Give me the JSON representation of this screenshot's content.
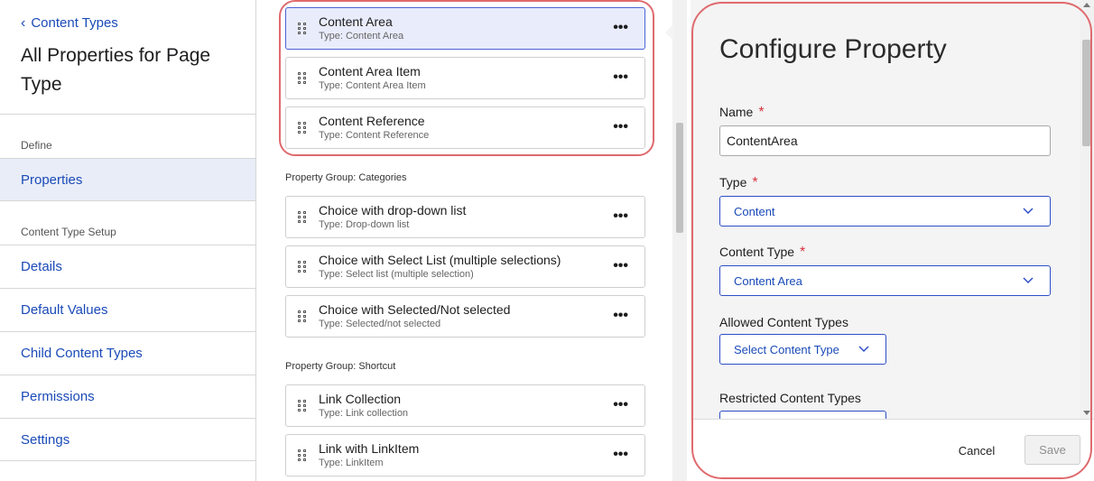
{
  "sidebar": {
    "back_label": "Content Types",
    "page_title": "All Properties for Page Type",
    "define_label": "Define",
    "properties_label": "Properties",
    "setup_label": "Content Type Setup",
    "items": [
      {
        "label": "Details"
      },
      {
        "label": "Default Values"
      },
      {
        "label": "Child Content Types"
      },
      {
        "label": "Permissions"
      },
      {
        "label": "Settings"
      }
    ]
  },
  "list": {
    "top_cards": [
      {
        "title": "Content Area",
        "type": "Type: Content Area"
      },
      {
        "title": "Content Area Item",
        "type": "Type: Content Area Item"
      },
      {
        "title": "Content Reference",
        "type": "Type: Content Reference"
      }
    ],
    "group_categories": "Property Group: Categories",
    "category_cards": [
      {
        "title": "Choice with drop-down list",
        "type": "Type: Drop-down list"
      },
      {
        "title": "Choice with Select List (multiple selections)",
        "type": "Type: Select list (multiple selection)"
      },
      {
        "title": "Choice with Selected/Not selected",
        "type": "Type: Selected/not selected"
      }
    ],
    "group_shortcut": "Property Group: Shortcut",
    "shortcut_cards": [
      {
        "title": "Link Collection",
        "type": "Type: Link collection"
      },
      {
        "title": "Link with LinkItem",
        "type": "Type: LinkItem"
      }
    ],
    "more_label": "•••"
  },
  "panel": {
    "title": "Configure Property",
    "name_label": "Name",
    "name_value": "ContentArea",
    "type_label": "Type",
    "type_value": "Content",
    "content_type_label": "Content Type",
    "content_type_value": "Content Area",
    "allowed_label": "Allowed Content Types",
    "allowed_value": "Select Content Type",
    "restricted_label": "Restricted Content Types",
    "required_mark": "*",
    "cancel_label": "Cancel",
    "save_label": "Save"
  },
  "colors": {
    "accent": "#1a4ab8",
    "highlight": "#e06a6e",
    "selected_bg": "#e9ecfb",
    "required": "#d6333f"
  }
}
